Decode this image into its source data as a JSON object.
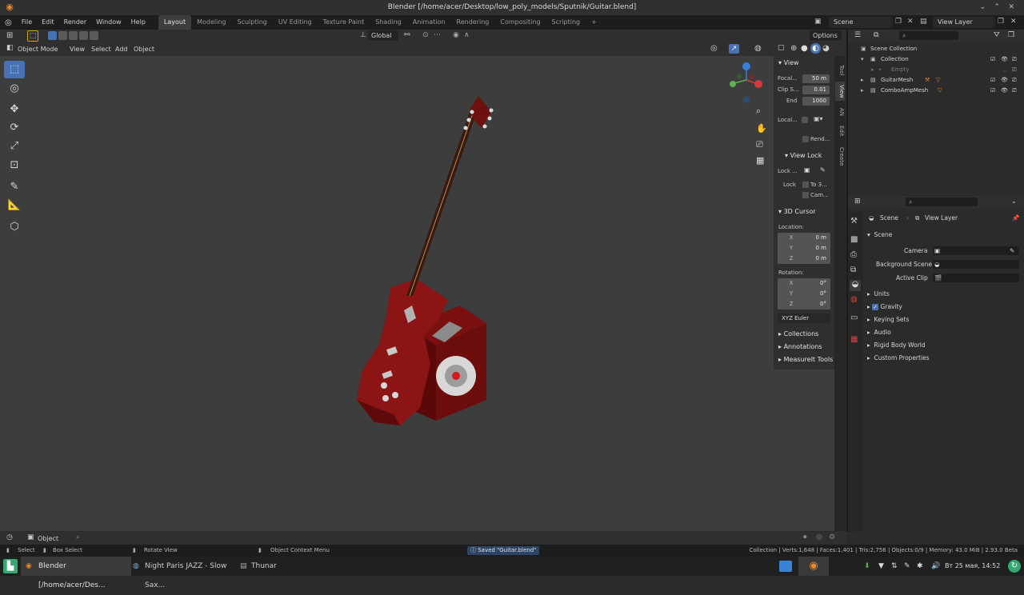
{
  "window": {
    "title": "Blender [/home/acer/Desktop/low_poly_models/Sputnik/Guitar.blend]",
    "controls": [
      "⌄",
      "⌃",
      "✕"
    ]
  },
  "menubar": {
    "menus": [
      "File",
      "Edit",
      "Render",
      "Window",
      "Help"
    ],
    "workspaces": [
      "Layout",
      "Modeling",
      "Sculpting",
      "UV Editing",
      "Texture Paint",
      "Shading",
      "Animation",
      "Rendering",
      "Compositing",
      "Scripting"
    ],
    "active_workspace": "Layout",
    "add_workspace": "+",
    "scene_name": "Scene",
    "view_layer": "View Layer"
  },
  "toolheader": {
    "orientation": "Global",
    "options": "Options"
  },
  "viewport_header": {
    "mode": "Object Mode",
    "menus": [
      "View",
      "Select",
      "Add",
      "Object"
    ]
  },
  "npanel": {
    "tabs": [
      "Tool",
      "View",
      "AN",
      "Edit",
      "Create"
    ],
    "view": {
      "title": "View",
      "focal_label": "Focal...",
      "focal_value": "50 m",
      "clip_start_label": "Clip S...",
      "clip_start_value": "0.01",
      "clip_end_label": "End",
      "clip_end_value": "1000",
      "local_label": "Local...",
      "render_label": "Rend..."
    },
    "view_lock": {
      "title": "View Lock",
      "lock_object_label": "Lock ...",
      "lock_label": "Lock",
      "to3d_label": "To 3...",
      "camera_label": "Cam..."
    },
    "cursor": {
      "title": "3D Cursor",
      "location_label": "Location:",
      "loc": [
        {
          "axis": "X",
          "value": "0 m"
        },
        {
          "axis": "Y",
          "value": "0 m"
        },
        {
          "axis": "Z",
          "value": "0 m"
        }
      ],
      "rotation_label": "Rotation:",
      "rot": [
        {
          "axis": "X",
          "value": "0°"
        },
        {
          "axis": "Y",
          "value": "0°"
        },
        {
          "axis": "Z",
          "value": "0°"
        }
      ],
      "rotation_mode": "XYZ Euler"
    },
    "collapsed": [
      "Collections",
      "Annotations",
      "MeasureIt Tools"
    ]
  },
  "outliner": {
    "root": "Scene Collection",
    "items": [
      {
        "label": "Collection",
        "level": 1
      },
      {
        "label": "Empty",
        "level": 2
      },
      {
        "label": "GuitarMesh",
        "level": 1
      },
      {
        "label": "ComboAmpMesh",
        "level": 1
      }
    ]
  },
  "properties": {
    "breadcrumb_scene": "Scene",
    "breadcrumb_layer": "View Layer",
    "section": "Scene",
    "camera_label": "Camera",
    "background_label": "Background Scene",
    "active_clip_label": "Active Clip",
    "panels": [
      "Units",
      "Gravity",
      "Keying Sets",
      "Audio",
      "Rigid Body World",
      "Custom Properties"
    ],
    "gravity_checked": true
  },
  "timeline": {
    "object_label": "Object"
  },
  "statusbar": {
    "select": "Select",
    "box_select": "Box Select",
    "rotate_view": "Rotate View",
    "context_menu": "Object Context Menu",
    "saved": "Saved \"Guitar.blend\"",
    "stats": "Collection | Verts:1,648 | Faces:1,401 | Tris:2,756 | Objects:0/9 | Memory: 43.0 MiB | 2.93.0 Beta"
  },
  "taskbar": {
    "task1": "Blender [/home/acer/Des...",
    "task2": "Night Paris JAZZ - Slow Sax...",
    "task3": "Thunar",
    "clock": "Вт 25 мая, 14:52"
  },
  "colors": {
    "accent": "#4772b3",
    "guitar_red": "#8b1414",
    "viewport_bg": "#3d3d3d",
    "orange_icon": "#e8872c"
  }
}
